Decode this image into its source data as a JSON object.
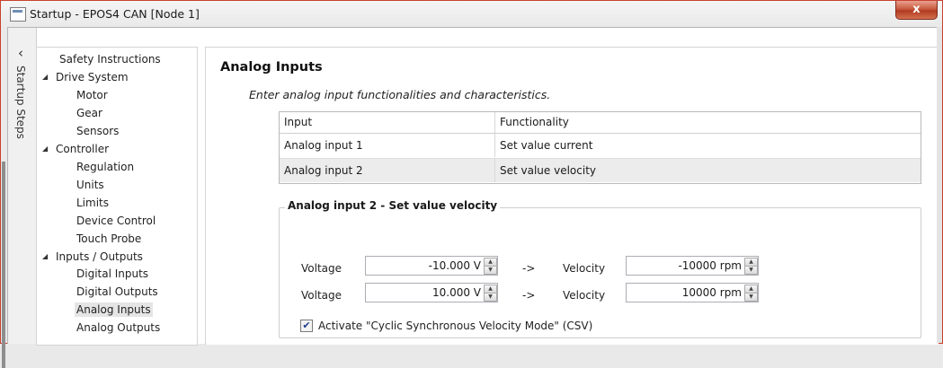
{
  "window": {
    "title": "Startup - EPOS4 CAN [Node 1]",
    "close_label": "x"
  },
  "side_tab": {
    "label": "Startup Steps",
    "collapse_icon": "chevron-left-icon",
    "chevron": "‹"
  },
  "tree": {
    "safety": "Safety Instructions",
    "drive_system": "Drive System",
    "motor": "Motor",
    "gear": "Gear",
    "sensors": "Sensors",
    "controller": "Controller",
    "regulation": "Regulation",
    "units": "Units",
    "limits": "Limits",
    "device_control": "Device Control",
    "touch_probe": "Touch Probe",
    "io": "Inputs / Outputs",
    "digital_inputs": "Digital Inputs",
    "digital_outputs": "Digital Outputs",
    "analog_inputs": "Analog Inputs",
    "analog_outputs": "Analog Outputs",
    "expanded_glyph": "◢"
  },
  "main": {
    "heading": "Analog Inputs",
    "subtitle": "Enter analog input functionalities and characteristics.",
    "table": {
      "headers": [
        "Input",
        "Functionality"
      ],
      "rows": [
        {
          "input": "Analog input 1",
          "functionality": "Set value current"
        },
        {
          "input": "Analog input 2",
          "functionality": "Set value velocity"
        }
      ]
    },
    "group": {
      "title": "Analog input 2 - Set value velocity",
      "row1": {
        "label": "Voltage",
        "voltage": "-10.000 V",
        "arrow": "->",
        "label2": "Velocity",
        "velocity": "-10000 rpm"
      },
      "row2": {
        "label": "Voltage",
        "voltage": "10.000 V",
        "arrow": "->",
        "label2": "Velocity",
        "velocity": "10000 rpm"
      },
      "checkbox_label": "Activate \"Cyclic Synchronous Velocity Mode\" (CSV)",
      "checkbox_checked": true,
      "check_glyph": "✔"
    },
    "spin_up": "▲",
    "spin_down": "▼"
  }
}
